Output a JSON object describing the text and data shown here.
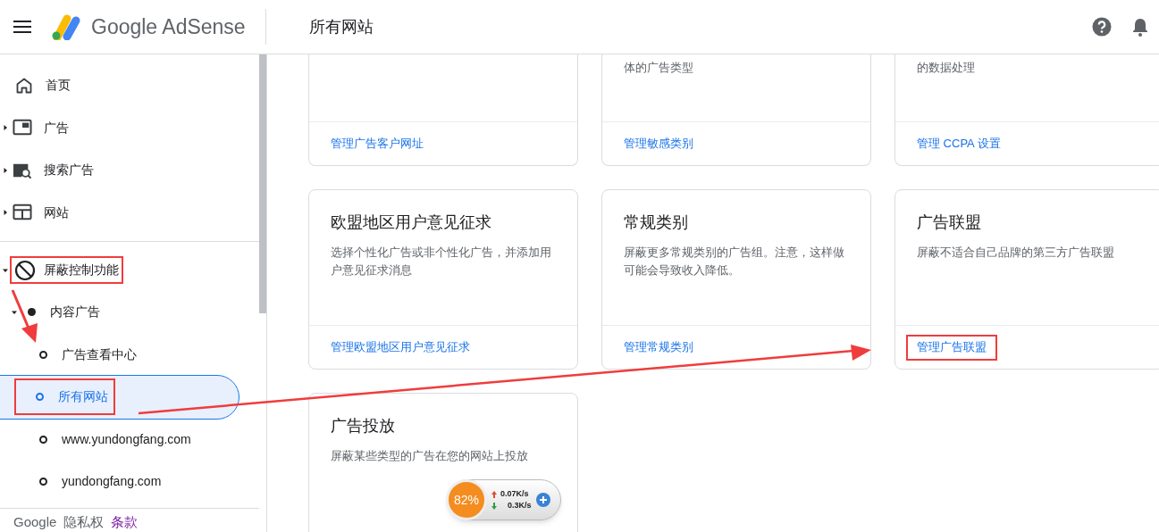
{
  "header": {
    "product_name": "Google AdSense",
    "page_title": "所有网站"
  },
  "sidebar": {
    "items": [
      {
        "label": "首页"
      },
      {
        "label": "广告",
        "expanded": false
      },
      {
        "label": "搜索广告",
        "expanded": false
      },
      {
        "label": "网站",
        "expanded": false
      },
      {
        "label": "屏蔽控制功能",
        "expanded": true,
        "boxed": true,
        "children": [
          {
            "label": "内容广告",
            "expanded": true,
            "children": [
              {
                "label": "广告查看中心",
                "selected": false,
                "boxed": false
              },
              {
                "label": "所有网站",
                "selected": true,
                "boxed": true
              },
              {
                "label": "www.yundongfang.com",
                "selected": false,
                "boxed": false
              },
              {
                "label": "yundongfang.com",
                "selected": false,
                "boxed": false
              }
            ]
          }
        ]
      }
    ],
    "footer": [
      {
        "text": "Google",
        "kind": "brand"
      },
      {
        "text": "隐私权",
        "kind": "text"
      },
      {
        "text": "条款",
        "kind": "link"
      }
    ]
  },
  "cards": [
    {
      "link": "管理广告客户网址",
      "boxed": false
    },
    {
      "description": "体的广告类型",
      "link": "管理敏感类别",
      "boxed": false
    },
    {
      "description": "的数据处理",
      "link": "管理 CCPA 设置",
      "boxed": false
    },
    {
      "title": "欧盟地区用户意见征求",
      "description": "选择个性化广告或非个性化广告，并添加用户意见征求消息",
      "link": "管理欧盟地区用户意见征求",
      "boxed": false
    },
    {
      "title": "常规类别",
      "description": "屏蔽更多常规类别的广告组。注意，这样做可能会导致收入降低。",
      "link": "管理常规类别",
      "boxed": false
    },
    {
      "title": "广告联盟",
      "description": "屏蔽不适合自己品牌的第三方广告联盟",
      "link": "管理广告联盟",
      "boxed": true
    },
    {
      "title": "广告投放",
      "description": "屏蔽某些类型的广告在您的网站上投放"
    }
  ],
  "network_widget": {
    "percent": "82%",
    "upload": "0.07K/s",
    "download": "0.3K/s"
  }
}
